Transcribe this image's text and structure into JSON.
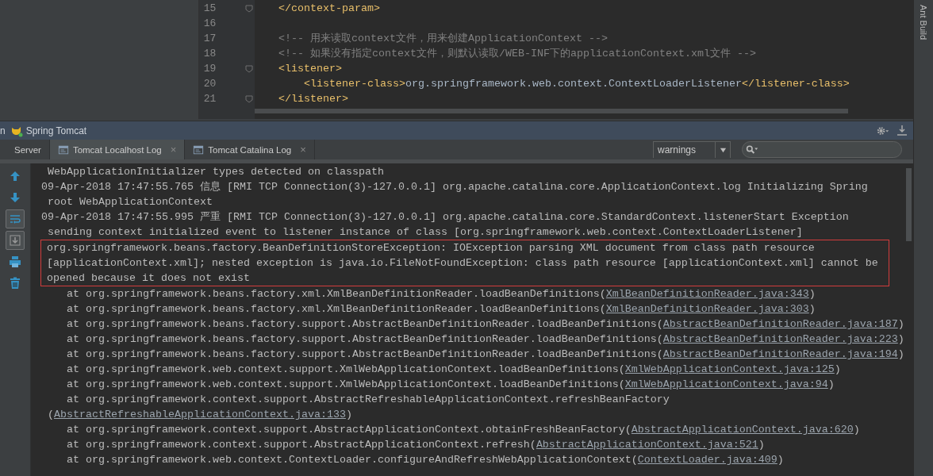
{
  "editor": {
    "lines": [
      {
        "number": "15",
        "fold": true,
        "segments": [
          {
            "kind": "tag",
            "text": "</context-param>"
          }
        ]
      },
      {
        "number": "16",
        "fold": false
      },
      {
        "number": "17",
        "fold": false,
        "segments": [
          {
            "kind": "comment",
            "text": "<!-- 用来读取context文件，用来创建ApplicationContext -->"
          }
        ]
      },
      {
        "number": "18",
        "fold": false,
        "segments": [
          {
            "kind": "comment",
            "text": "<!-- 如果没有指定context文件，则默认读取/WEB-INF下的applicationContext.xml文件 -->"
          }
        ]
      },
      {
        "number": "19",
        "fold": true,
        "segments": [
          {
            "kind": "tag",
            "text": "<listener>"
          }
        ]
      },
      {
        "number": "20",
        "fold": false,
        "indent": true,
        "segments": [
          {
            "kind": "tag",
            "text": "<listener-class>"
          },
          {
            "kind": "text",
            "text": "org.springframework.web.context.ContextLoaderListener"
          },
          {
            "kind": "tag",
            "text": "</listener-class>"
          }
        ]
      },
      {
        "number": "21",
        "fold": true,
        "segments": [
          {
            "kind": "tag",
            "text": "</listener>"
          }
        ]
      }
    ]
  },
  "side_strip": {
    "label": "Ant Build"
  },
  "tool_window": {
    "name_fragment": "n",
    "title": "Spring Tomcat"
  },
  "tabs": [
    {
      "label": "Server",
      "kind": "plain",
      "selected": false
    },
    {
      "label": "Tomcat Localhost Log",
      "kind": "log",
      "selected": true,
      "close": "×"
    },
    {
      "label": "Tomcat Catalina Log",
      "kind": "log",
      "selected": false,
      "close": "×"
    }
  ],
  "filter": {
    "value": "warnings"
  },
  "toolbar": [
    {
      "kind": "up",
      "on": false
    },
    {
      "kind": "down",
      "on": false
    },
    {
      "kind": "wrap",
      "on": true
    },
    {
      "kind": "scroll_end",
      "on": true
    },
    {
      "kind": "print",
      "on": false
    },
    {
      "kind": "clear",
      "on": false
    }
  ],
  "log": {
    "entries": [
      {
        "kind": "cont",
        "text": "WebApplicationInitializer types detected on classpath"
      },
      {
        "kind": "head",
        "text": "09-Apr-2018 17:47:55.765 信息 [RMI TCP Connection(3)-127.0.0.1] org.apache.catalina.core.ApplicationContext.log Initializing Spring"
      },
      {
        "kind": "cont",
        "text": "root WebApplicationContext"
      },
      {
        "kind": "head",
        "text": "09-Apr-2018 17:47:55.995 严重 [RMI TCP Connection(3)-127.0.0.1] org.apache.catalina.core.StandardContext.listenerStart Exception"
      },
      {
        "kind": "cont",
        "text": "sending context initialized event to listener instance of class [org.springframework.web.context.ContextLoaderListener]"
      },
      {
        "kind": "box",
        "lines": [
          {
            "kind": "cont",
            "text": "org.springframework.beans.factory.BeanDefinitionStoreException: IOException parsing XML document from class path resource"
          },
          {
            "kind": "cont",
            "text": "[applicationContext.xml]; nested exception is java.io.FileNotFoundException: class path resource [applicationContext.xml] cannot be"
          },
          {
            "kind": "cont",
            "text": "opened because it does not exist"
          }
        ]
      },
      {
        "kind": "frame",
        "text": "at org.springframework.beans.factory.xml.XmlBeanDefinitionReader.loadBeanDefinitions(",
        "link": "XmlBeanDefinitionReader.java:343",
        "end": ")"
      },
      {
        "kind": "frame",
        "text": "at org.springframework.beans.factory.xml.XmlBeanDefinitionReader.loadBeanDefinitions(",
        "link": "XmlBeanDefinitionReader.java:303",
        "end": ")"
      },
      {
        "kind": "frame",
        "text": "at org.springframework.beans.factory.support.AbstractBeanDefinitionReader.loadBeanDefinitions(",
        "link": "AbstractBeanDefinitionReader.java:187",
        "end": ")"
      },
      {
        "kind": "frame",
        "text": "at org.springframework.beans.factory.support.AbstractBeanDefinitionReader.loadBeanDefinitions(",
        "link": "AbstractBeanDefinitionReader.java:223",
        "end": ")"
      },
      {
        "kind": "frame",
        "text": "at org.springframework.beans.factory.support.AbstractBeanDefinitionReader.loadBeanDefinitions(",
        "link": "AbstractBeanDefinitionReader.java:194",
        "end": ")"
      },
      {
        "kind": "frame",
        "text": "at org.springframework.web.context.support.XmlWebApplicationContext.loadBeanDefinitions(",
        "link": "XmlWebApplicationContext.java:125",
        "end": ")"
      },
      {
        "kind": "frame",
        "text": "at org.springframework.web.context.support.XmlWebApplicationContext.loadBeanDefinitions(",
        "link": "XmlWebApplicationContext.java:94",
        "end": ")"
      },
      {
        "kind": "frame",
        "text": "at org.springframework.context.support.AbstractRefreshableApplicationContext.refreshBeanFactory"
      },
      {
        "kind": "cont",
        "text": "(",
        "link": "AbstractRefreshableApplicationContext.java:133",
        "end": ")"
      },
      {
        "kind": "frame",
        "text": "at org.springframework.context.support.AbstractApplicationContext.obtainFreshBeanFactory(",
        "link": "AbstractApplicationContext.java:620",
        "end": ")"
      },
      {
        "kind": "frame",
        "text": "at org.springframework.context.support.AbstractApplicationContext.refresh(",
        "link": "AbstractApplicationContext.java:521",
        "end": ")"
      },
      {
        "kind": "frame",
        "text": "at org.springframework.web.context.ContextLoader.configureAndRefreshWebApplicationContext(",
        "link": "ContextLoader.java:409",
        "end": ")"
      }
    ]
  }
}
